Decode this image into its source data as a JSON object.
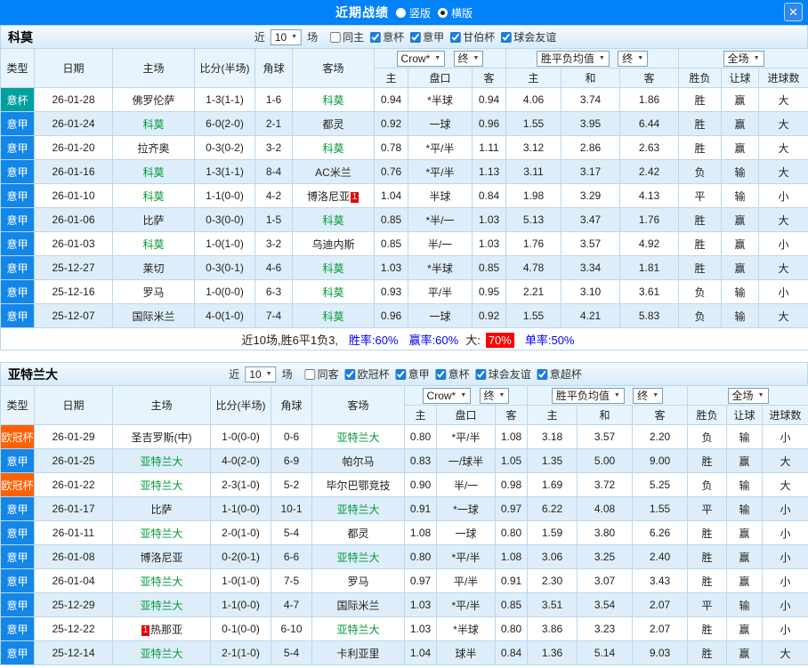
{
  "topbar": {
    "title": "近期战绩",
    "options": [
      {
        "label": "竖版",
        "selected": false
      },
      {
        "label": "横版",
        "selected": true
      }
    ],
    "close_icon": "✕"
  },
  "colors": {
    "topbar_blue": "#0182f8",
    "serie_a_badge": "#1486e8",
    "italy_cup_badge": "#00a0a0",
    "ucl_badge": "#ff6000",
    "win_red": "#ff0000",
    "draw_loss_blue": "#0000e0",
    "lose_green": "#009933",
    "score_red": "#ff0000",
    "focus_team_green": "#009933"
  },
  "sections": [
    {
      "team": "科莫",
      "recent": {
        "prefix": "近",
        "count": "10",
        "suffix": "场"
      },
      "filters": [
        {
          "label": "同主",
          "checked": false
        },
        {
          "label": "意杯",
          "checked": true
        },
        {
          "label": "意甲",
          "checked": true
        },
        {
          "label": "甘伯杯",
          "checked": true
        },
        {
          "label": "球会友谊",
          "checked": true
        }
      ],
      "selects": [
        "Crow*",
        "终",
        "胜平负均值",
        "终",
        "全场"
      ],
      "columns": [
        "类型",
        "日期",
        "主场",
        "比分(半场)",
        "角球",
        "客场",
        "主",
        "盘口",
        "客",
        "主",
        "和",
        "客",
        "胜负",
        "让球",
        "进球数"
      ],
      "rows": [
        {
          "type": "意杯",
          "league": "itcup",
          "date": "26-01-28",
          "home": {
            "name": "佛罗伦萨"
          },
          "score": "1-3(1-1)",
          "corners": "1-6",
          "away": {
            "name": "科莫",
            "focus": true
          },
          "ah": [
            "0.94",
            "*半球",
            "0.94"
          ],
          "eu": [
            "4.06",
            "3.74",
            "1.86"
          ],
          "res": [
            [
              "胜",
              "r"
            ],
            [
              "赢",
              "r"
            ],
            [
              "大",
              "r"
            ]
          ]
        },
        {
          "type": "意甲",
          "league": "seriea",
          "date": "26-01-24",
          "home": {
            "name": "科莫",
            "focus": true
          },
          "score": "6-0(2-0)",
          "corners": "2-1",
          "away": {
            "name": "都灵"
          },
          "ah": [
            "0.92",
            "一球",
            "0.96"
          ],
          "eu": [
            "1.55",
            "3.95",
            "6.44"
          ],
          "res": [
            [
              "胜",
              "r"
            ],
            [
              "赢",
              "r"
            ],
            [
              "大",
              "r"
            ]
          ]
        },
        {
          "type": "意甲",
          "league": "seriea",
          "date": "26-01-20",
          "home": {
            "name": "拉齐奥"
          },
          "score": "0-3(0-2)",
          "corners": "3-2",
          "away": {
            "name": "科莫",
            "focus": true
          },
          "ah": [
            "0.78",
            "*平/半",
            "1.11"
          ],
          "eu": [
            "3.12",
            "2.86",
            "2.63"
          ],
          "res": [
            [
              "胜",
              "r"
            ],
            [
              "赢",
              "r"
            ],
            [
              "大",
              "r"
            ]
          ]
        },
        {
          "type": "意甲",
          "league": "seriea",
          "date": "26-01-16",
          "home": {
            "name": "科莫",
            "focus": true
          },
          "score": "1-3(1-1)",
          "corners": "8-4",
          "away": {
            "name": "AC米兰"
          },
          "ah": [
            "0.76",
            "*平/半",
            "1.13"
          ],
          "eu": [
            "3.11",
            "3.17",
            "2.42"
          ],
          "res": [
            [
              "负",
              "b"
            ],
            [
              "输",
              "g"
            ],
            [
              "大",
              "r"
            ]
          ]
        },
        {
          "type": "意甲",
          "league": "seriea",
          "date": "26-01-10",
          "home": {
            "name": "科莫",
            "focus": true
          },
          "score": "1-1(0-0)",
          "corners": "4-2",
          "away": {
            "name": "博洛尼亚",
            "red": "1",
            "red_pos": "after"
          },
          "ah": [
            "1.04",
            "半球",
            "0.84"
          ],
          "eu": [
            "1.98",
            "3.29",
            "4.13"
          ],
          "res": [
            [
              "平",
              "b"
            ],
            [
              "输",
              "g"
            ],
            [
              "小",
              "g"
            ]
          ]
        },
        {
          "type": "意甲",
          "league": "seriea",
          "date": "26-01-06",
          "home": {
            "name": "比萨"
          },
          "score": "0-3(0-0)",
          "corners": "1-5",
          "away": {
            "name": "科莫",
            "focus": true
          },
          "ah": [
            "0.85",
            "*半/一",
            "1.03"
          ],
          "eu": [
            "5.13",
            "3.47",
            "1.76"
          ],
          "res": [
            [
              "胜",
              "r"
            ],
            [
              "赢",
              "r"
            ],
            [
              "大",
              "r"
            ]
          ]
        },
        {
          "type": "意甲",
          "league": "seriea",
          "date": "26-01-03",
          "home": {
            "name": "科莫",
            "focus": true
          },
          "score": "1-0(1-0)",
          "corners": "3-2",
          "away": {
            "name": "乌迪内斯"
          },
          "ah": [
            "0.85",
            "半/一",
            "1.03"
          ],
          "eu": [
            "1.76",
            "3.57",
            "4.92"
          ],
          "res": [
            [
              "胜",
              "r"
            ],
            [
              "赢",
              "r"
            ],
            [
              "小",
              "g"
            ]
          ]
        },
        {
          "type": "意甲",
          "league": "seriea",
          "date": "25-12-27",
          "home": {
            "name": "莱切"
          },
          "score": "0-3(0-1)",
          "corners": "4-6",
          "away": {
            "name": "科莫",
            "focus": true
          },
          "ah": [
            "1.03",
            "*半球",
            "0.85"
          ],
          "eu": [
            "4.78",
            "3.34",
            "1.81"
          ],
          "res": [
            [
              "胜",
              "r"
            ],
            [
              "赢",
              "r"
            ],
            [
              "大",
              "r"
            ]
          ]
        },
        {
          "type": "意甲",
          "league": "seriea",
          "date": "25-12-16",
          "home": {
            "name": "罗马"
          },
          "score": "1-0(0-0)",
          "corners": "6-3",
          "away": {
            "name": "科莫",
            "focus": true
          },
          "ah": [
            "0.93",
            "平/半",
            "0.95"
          ],
          "eu": [
            "2.21",
            "3.10",
            "3.61"
          ],
          "res": [
            [
              "负",
              "b"
            ],
            [
              "输",
              "g"
            ],
            [
              "小",
              "g"
            ]
          ]
        },
        {
          "type": "意甲",
          "league": "seriea",
          "date": "25-12-07",
          "home": {
            "name": "国际米兰"
          },
          "score": "4-0(1-0)",
          "corners": "7-4",
          "away": {
            "name": "科莫",
            "focus": true
          },
          "ah": [
            "0.96",
            "一球",
            "0.92"
          ],
          "eu": [
            "1.55",
            "4.21",
            "5.83"
          ],
          "res": [
            [
              "负",
              "b"
            ],
            [
              "输",
              "g"
            ],
            [
              "大",
              "r"
            ]
          ]
        }
      ],
      "summary": [
        [
          "近10场,胜6平1负3,",
          "plain"
        ],
        [
          "胜率:60%",
          "blue"
        ],
        [
          "赢率:60%",
          "blue"
        ],
        [
          "大:",
          "plain"
        ],
        [
          "70%",
          "redbox"
        ],
        [
          "单率:50%",
          "blue"
        ]
      ]
    },
    {
      "team": "亚特兰大",
      "recent": {
        "prefix": "近",
        "count": "10",
        "suffix": "场"
      },
      "filters": [
        {
          "label": "同客",
          "checked": false
        },
        {
          "label": "欧冠杯",
          "checked": true
        },
        {
          "label": "意甲",
          "checked": true
        },
        {
          "label": "意杯",
          "checked": true
        },
        {
          "label": "球会友谊",
          "checked": true
        },
        {
          "label": "意超杯",
          "checked": true
        }
      ],
      "selects": [
        "Crow*",
        "终",
        "胜平负均值",
        "终",
        "全场"
      ],
      "columns": [
        "类型",
        "日期",
        "主场",
        "比分(半场)",
        "角球",
        "客场",
        "主",
        "盘口",
        "客",
        "主",
        "和",
        "客",
        "胜负",
        "让球",
        "进球数"
      ],
      "rows": [
        {
          "type": "欧冠杯",
          "league": "ucl",
          "date": "26-01-29",
          "home": {
            "name": "圣吉罗斯(中)"
          },
          "score": "1-0(0-0)",
          "corners": "0-6",
          "away": {
            "name": "亚特兰大",
            "focus": true
          },
          "ah": [
            "0.80",
            "*平/半",
            "1.08"
          ],
          "eu": [
            "3.18",
            "3.57",
            "2.20"
          ],
          "res": [
            [
              "负",
              "b"
            ],
            [
              "输",
              "g"
            ],
            [
              "小",
              "g"
            ]
          ]
        },
        {
          "type": "意甲",
          "league": "seriea",
          "date": "26-01-25",
          "home": {
            "name": "亚特兰大",
            "focus": true
          },
          "score": "4-0(2-0)",
          "corners": "6-9",
          "away": {
            "name": "帕尔马"
          },
          "ah": [
            "0.83",
            "一/球半",
            "1.05"
          ],
          "eu": [
            "1.35",
            "5.00",
            "9.00"
          ],
          "res": [
            [
              "胜",
              "r"
            ],
            [
              "赢",
              "r"
            ],
            [
              "大",
              "r"
            ]
          ]
        },
        {
          "type": "欧冠杯",
          "league": "ucl",
          "date": "26-01-22",
          "home": {
            "name": "亚特兰大",
            "focus": true
          },
          "score": "2-3(1-0)",
          "corners": "5-2",
          "away": {
            "name": "毕尔巴鄂竞技"
          },
          "ah": [
            "0.90",
            "半/一",
            "0.98"
          ],
          "eu": [
            "1.69",
            "3.72",
            "5.25"
          ],
          "res": [
            [
              "负",
              "b"
            ],
            [
              "输",
              "g"
            ],
            [
              "大",
              "r"
            ]
          ]
        },
        {
          "type": "意甲",
          "league": "seriea",
          "date": "26-01-17",
          "home": {
            "name": "比萨"
          },
          "score": "1-1(0-0)",
          "corners": "10-1",
          "away": {
            "name": "亚特兰大",
            "focus": true
          },
          "ah": [
            "0.91",
            "*一球",
            "0.97"
          ],
          "eu": [
            "6.22",
            "4.08",
            "1.55"
          ],
          "res": [
            [
              "平",
              "b"
            ],
            [
              "输",
              "g"
            ],
            [
              "小",
              "g"
            ]
          ]
        },
        {
          "type": "意甲",
          "league": "seriea",
          "date": "26-01-11",
          "home": {
            "name": "亚特兰大",
            "focus": true
          },
          "score": "2-0(1-0)",
          "corners": "5-4",
          "away": {
            "name": "都灵"
          },
          "ah": [
            "1.08",
            "一球",
            "0.80"
          ],
          "eu": [
            "1.59",
            "3.80",
            "6.26"
          ],
          "res": [
            [
              "胜",
              "r"
            ],
            [
              "赢",
              "r"
            ],
            [
              "小",
              "g"
            ]
          ]
        },
        {
          "type": "意甲",
          "league": "seriea",
          "date": "26-01-08",
          "home": {
            "name": "博洛尼亚"
          },
          "score": "0-2(0-1)",
          "corners": "6-6",
          "away": {
            "name": "亚特兰大",
            "focus": true
          },
          "ah": [
            "0.80",
            "*平/半",
            "1.08"
          ],
          "eu": [
            "3.06",
            "3.25",
            "2.40"
          ],
          "res": [
            [
              "胜",
              "r"
            ],
            [
              "赢",
              "r"
            ],
            [
              "小",
              "g"
            ]
          ]
        },
        {
          "type": "意甲",
          "league": "seriea",
          "date": "26-01-04",
          "home": {
            "name": "亚特兰大",
            "focus": true
          },
          "score": "1-0(1-0)",
          "corners": "7-5",
          "away": {
            "name": "罗马"
          },
          "ah": [
            "0.97",
            "平/半",
            "0.91"
          ],
          "eu": [
            "2.30",
            "3.07",
            "3.43"
          ],
          "res": [
            [
              "胜",
              "r"
            ],
            [
              "赢",
              "r"
            ],
            [
              "小",
              "g"
            ]
          ]
        },
        {
          "type": "意甲",
          "league": "seriea",
          "date": "25-12-29",
          "home": {
            "name": "亚特兰大",
            "focus": true
          },
          "score": "1-1(0-0)",
          "corners": "4-7",
          "away": {
            "name": "国际米兰"
          },
          "ah": [
            "1.03",
            "*平/半",
            "0.85"
          ],
          "eu": [
            "3.51",
            "3.54",
            "2.07"
          ],
          "res": [
            [
              "平",
              "b"
            ],
            [
              "输",
              "g"
            ],
            [
              "小",
              "g"
            ]
          ]
        },
        {
          "type": "意甲",
          "league": "seriea",
          "date": "25-12-22",
          "home": {
            "name": "热那亚",
            "red": "1",
            "red_pos": "before"
          },
          "score": "0-1(0-0)",
          "corners": "6-10",
          "away": {
            "name": "亚特兰大",
            "focus": true
          },
          "ah": [
            "1.03",
            "*半球",
            "0.80"
          ],
          "eu": [
            "3.86",
            "3.23",
            "2.07"
          ],
          "res": [
            [
              "胜",
              "r"
            ],
            [
              "赢",
              "r"
            ],
            [
              "小",
              "g"
            ]
          ]
        },
        {
          "type": "意甲",
          "league": "seriea",
          "date": "25-12-14",
          "home": {
            "name": "亚特兰大",
            "focus": true
          },
          "score": "2-1(1-0)",
          "corners": "5-4",
          "away": {
            "name": "卡利亚里"
          },
          "ah": [
            "1.04",
            "球半",
            "0.84"
          ],
          "eu": [
            "1.36",
            "5.14",
            "9.03"
          ],
          "res": [
            [
              "胜",
              "r"
            ],
            [
              "赢",
              "r"
            ],
            [
              "大",
              "r"
            ]
          ]
        }
      ],
      "summary": null
    }
  ]
}
